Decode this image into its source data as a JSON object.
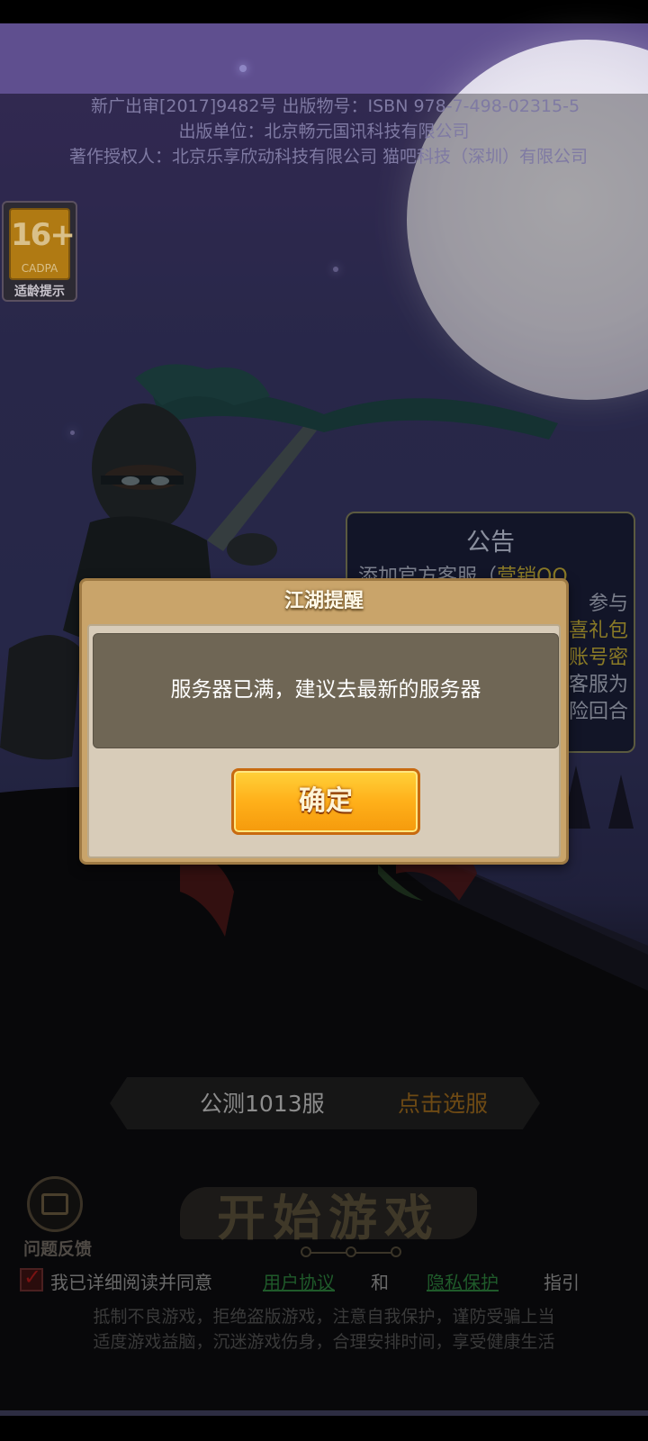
{
  "copyright": {
    "line1": "新广出审[2017]9482号   出版物号：ISBN 978-7-498-02315-5",
    "line2": "出版单位：北京畅元国讯科技有限公司",
    "line3": "著作授权人：北京乐享欣动科技有限公司 猫吧科技（深圳）有限公司"
  },
  "age_badge": {
    "number": "16+",
    "org": "CADPA",
    "label": "适龄提示"
  },
  "notice": {
    "title": "公告",
    "line1_prefix": "添加官方客服（",
    "line1_highlight": "营销QQ",
    "line2": "参与",
    "line3": "喜礼包",
    "line4": "账号密",
    "line5": "客服为",
    "line6": "险回合"
  },
  "dialog": {
    "title": "江湖提醒",
    "message": "服务器已满，建议去最新的服务器",
    "confirm_label": "确定"
  },
  "server": {
    "name": "公测1013服",
    "select_label": "点击选服"
  },
  "feedback": {
    "label": "问题反馈"
  },
  "start": {
    "label": "开始游戏"
  },
  "agreement": {
    "prefix": "我已详细阅读并同意",
    "user_agreement": "用户协议",
    "and": "和",
    "privacy": "隐私保护",
    "suffix": "指引",
    "checked": true
  },
  "health_notice": {
    "line1": "抵制不良游戏，拒绝盗版游戏，注意自我保护，谨防受骗上当",
    "line2": "适度游戏益脑，沉迷游戏伤身，合理安排时间，享受健康生活"
  },
  "colors": {
    "accent_gold": "#c9a46a",
    "button_orange": "#ffb01a",
    "link_green": "#1f5a2a"
  }
}
